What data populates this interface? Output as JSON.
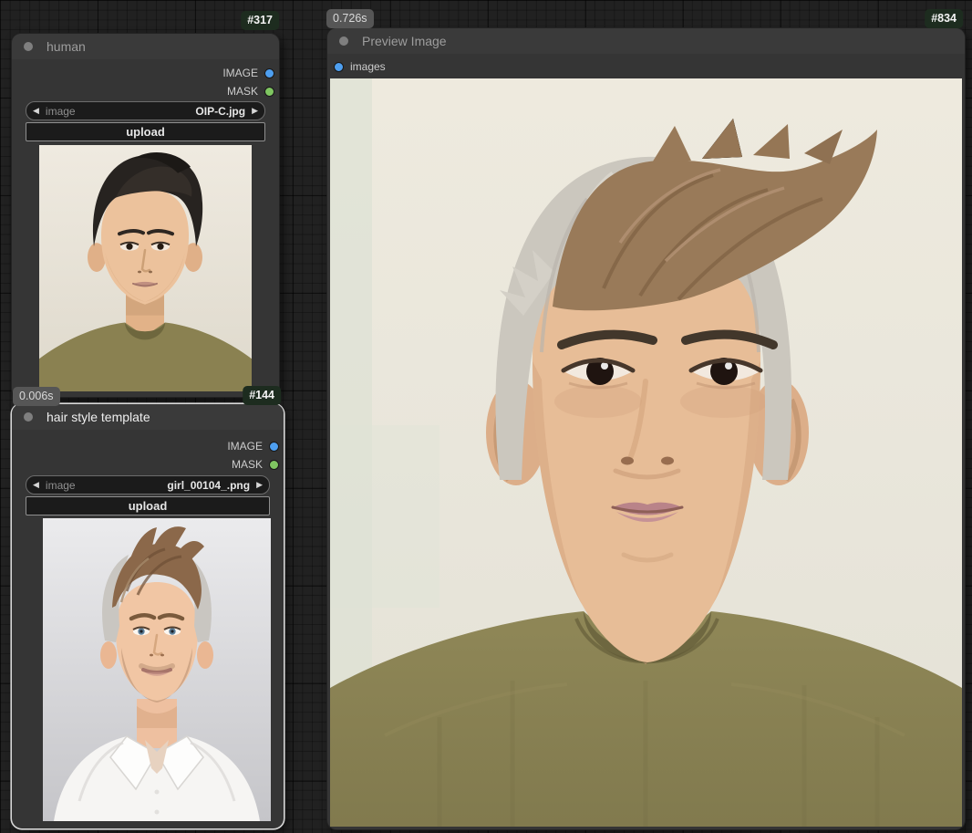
{
  "icons": {
    "prev_arrow": "◀",
    "next_arrow": "▶"
  },
  "palette": {
    "canvas_bg": "#212121",
    "node_bg": "#353535",
    "node_header_bg": "#3a3a3a",
    "selected_node_border": "#d8d8d8",
    "id_badge_bg": "#1d2c1f",
    "time_badge_bg": "#565656",
    "image_slot_color": "#4e9ff0",
    "mask_slot_color": "#7fc661",
    "widget_bg": "#1b1b1b",
    "portrait_bg_cream": "#eae6dc",
    "portrait_bg_gray": "#d9d9dc",
    "shirt_olive": "#8b8355",
    "shirt_white": "#f6f5f3",
    "hair_dark": "#272320",
    "hair_brown": "#997a59",
    "hair_silver": "#cbc7be"
  },
  "nodes": {
    "human": {
      "id_badge": "#317",
      "title": "human",
      "outputs": [
        {
          "label": "IMAGE"
        },
        {
          "label": "MASK"
        }
      ],
      "image_widget": {
        "label": "image",
        "value": "OIP-C.jpg"
      },
      "upload_label": "upload"
    },
    "hair_template": {
      "time_badge": "0.006s",
      "id_badge": "#144",
      "title": "hair style template",
      "outputs": [
        {
          "label": "IMAGE"
        },
        {
          "label": "MASK"
        }
      ],
      "image_widget": {
        "label": "image",
        "value": "girl_00104_.png"
      },
      "upload_label": "upload"
    },
    "preview": {
      "time_badge": "0.726s",
      "id_badge": "#834",
      "title": "Preview Image",
      "inputs": [
        {
          "label": "images"
        }
      ]
    }
  }
}
